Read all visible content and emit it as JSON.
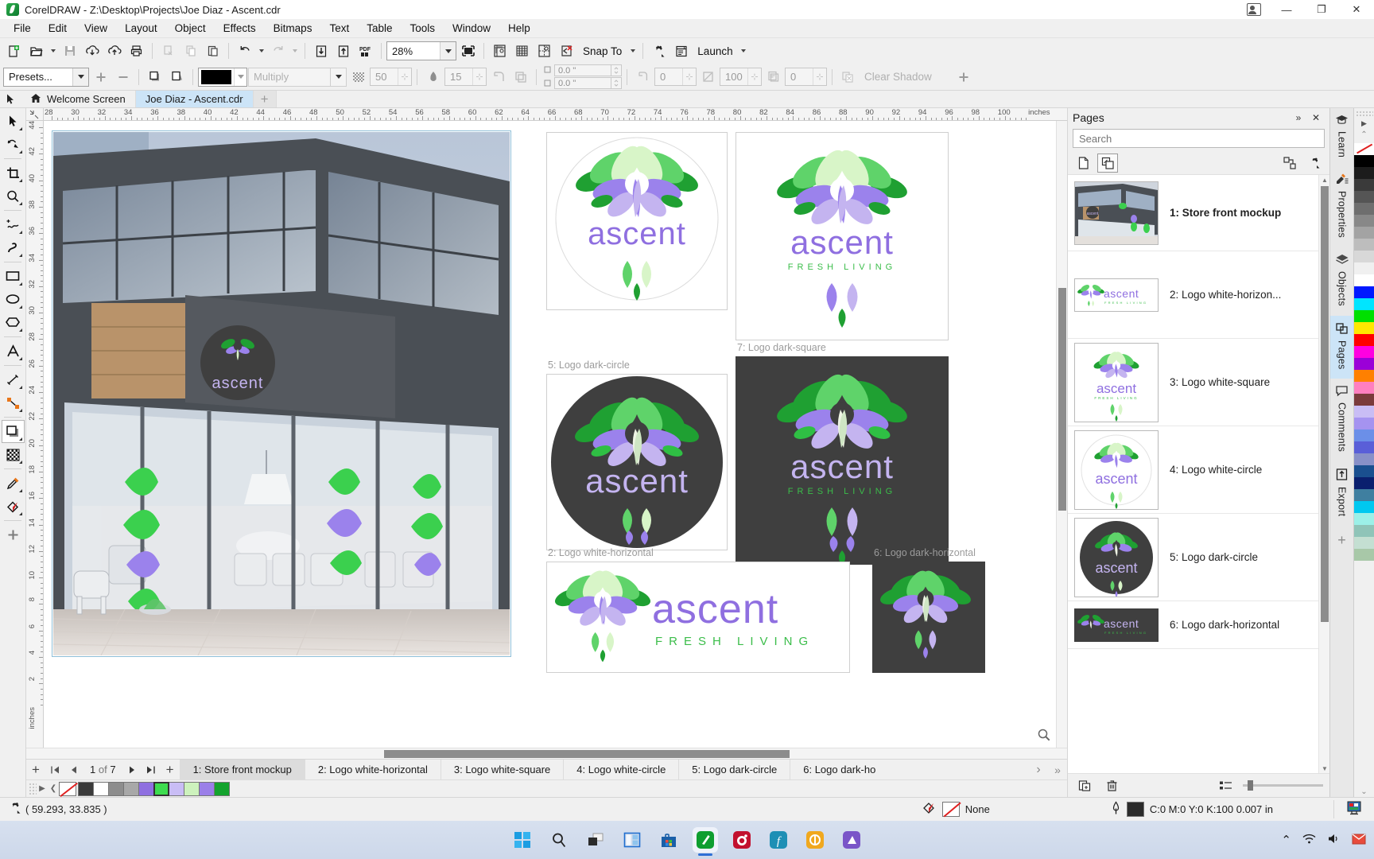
{
  "titlebar": {
    "app_name": "CorelDRAW",
    "title": "CorelDRAW - Z:\\Desktop\\Projects\\Joe Diaz - Ascent.cdr",
    "minimize": "—",
    "maximize": "❐",
    "close": "✕"
  },
  "menubar": {
    "items": [
      {
        "label": "File"
      },
      {
        "label": "Edit"
      },
      {
        "label": "View"
      },
      {
        "label": "Layout"
      },
      {
        "label": "Object"
      },
      {
        "label": "Effects"
      },
      {
        "label": "Bitmaps"
      },
      {
        "label": "Text"
      },
      {
        "label": "Table"
      },
      {
        "label": "Tools"
      },
      {
        "label": "Window"
      },
      {
        "label": "Help"
      }
    ]
  },
  "toolbar": {
    "zoom_level": "28%",
    "snap_to_label": "Snap To",
    "launch_label": "Launch",
    "items": [
      {
        "name": "new-document",
        "title": "New"
      },
      {
        "name": "open-document",
        "title": "Open"
      },
      {
        "name": "save-document",
        "title": "Save"
      },
      {
        "name": "import",
        "title": "Import"
      },
      {
        "name": "export",
        "title": "Export"
      },
      {
        "name": "print",
        "title": "Print"
      },
      {
        "name": "cut",
        "title": "Cut"
      },
      {
        "name": "copy",
        "title": "Copy"
      },
      {
        "name": "paste",
        "title": "Paste"
      },
      {
        "name": "undo",
        "title": "Undo"
      },
      {
        "name": "redo",
        "title": "Redo"
      },
      {
        "name": "publish-pdf",
        "title": "Publish to PDF"
      }
    ]
  },
  "propbar": {
    "presets_label": "Presets...",
    "merge_mode": "Multiply",
    "opacity": "50",
    "feather": "15",
    "offset_x": "0.0 \"",
    "offset_y": "0.0 \"",
    "stretch": "0",
    "fade": "100",
    "shadow_angle": "0",
    "clear_shadow_label": "Clear Shadow"
  },
  "doctabs": {
    "tabs": [
      {
        "label": "Welcome Screen",
        "active": false,
        "icon": "home-icon"
      },
      {
        "label": "Joe Diaz - Ascent.cdr",
        "active": true,
        "icon": null
      }
    ],
    "new_tab": "+"
  },
  "toolbox": {
    "tools": [
      {
        "name": "pick-tool",
        "selected": false
      },
      {
        "name": "shape-tool",
        "selected": false
      },
      {
        "name": "crop-tool",
        "selected": false
      },
      {
        "name": "zoom-tool",
        "selected": false
      },
      {
        "name": "freehand-tool",
        "selected": false
      },
      {
        "name": "artistic-media-tool",
        "selected": false
      },
      {
        "name": "rectangle-tool",
        "selected": false
      },
      {
        "name": "ellipse-tool",
        "selected": false
      },
      {
        "name": "polygon-tool",
        "selected": false
      },
      {
        "name": "text-tool",
        "selected": false
      },
      {
        "name": "parallel-dimension-tool",
        "selected": false
      },
      {
        "name": "straight-line-connector-tool",
        "selected": false
      },
      {
        "name": "drop-shadow-tool",
        "selected": true
      },
      {
        "name": "transparency-tool",
        "selected": false
      },
      {
        "name": "color-eyedropper-tool",
        "selected": false
      },
      {
        "name": "interactive-fill-tool",
        "selected": false
      },
      {
        "name": "add-tool",
        "selected": false
      }
    ]
  },
  "rulers": {
    "unit_label": "inches",
    "h_ticks": [
      "28",
      "30",
      "32",
      "34",
      "36",
      "38",
      "40",
      "42",
      "44",
      "46",
      "48",
      "50",
      "52",
      "54",
      "56",
      "58",
      "60",
      "62",
      "64",
      "66",
      "68",
      "70",
      "72",
      "74",
      "76",
      "78",
      "80",
      "82",
      "84",
      "86",
      "88",
      "90",
      "92",
      "94",
      "96",
      "98",
      "100"
    ],
    "v_ticks": [
      "44",
      "42",
      "40",
      "38",
      "36",
      "34",
      "32",
      "30",
      "28",
      "26",
      "24",
      "22",
      "20",
      "18",
      "16",
      "14",
      "12",
      "10",
      "8",
      "6",
      "4",
      "2"
    ],
    "v_unit_label": "inches"
  },
  "canvas": {
    "artboards": [
      {
        "label": "",
        "name": "store-front-mockup-art"
      },
      {
        "label": "4: Logo white-circle",
        "name": "logo-white-circle-art"
      },
      {
        "label": "3: Logo white-square",
        "name": "logo-white-square-art"
      },
      {
        "label": "5: Logo dark-circle",
        "name": "logo-dark-circle-art"
      },
      {
        "label": "7: Logo dark-square",
        "name": "logo-dark-square-art"
      },
      {
        "label": "2: Logo white-horizontal",
        "name": "logo-white-horizontal-art"
      },
      {
        "label": "6: Logo dark-horizontal",
        "name": "logo-dark-horizontal-art"
      }
    ],
    "brand_name": "ascent",
    "brand_tagline": "FRESH LIVING",
    "colors": {
      "purple": "#8f6fe0",
      "light_purple": "#c4b4f0",
      "green": "#22a038",
      "light_green": "#5fd36a",
      "pale_green": "#d8f5c8",
      "dark_bg": "#3f3f3f"
    }
  },
  "pagenav": {
    "add_page_before": "+",
    "first": "⏮",
    "prev": "◀",
    "counter_current": "1",
    "counter_of": "of",
    "counter_total": "7",
    "next": "▶",
    "last": "⏭",
    "add_page_after": "+",
    "tabs": [
      {
        "label": "1: Store front mockup",
        "active": true
      },
      {
        "label": "2: Logo white-horizontal",
        "active": false
      },
      {
        "label": "3: Logo white-square",
        "active": false
      },
      {
        "label": "4: Logo white-circle",
        "active": false
      },
      {
        "label": "5: Logo dark-circle",
        "active": false
      },
      {
        "label": "6: Logo dark-horizontal",
        "active": false
      }
    ],
    "scroll_right": "›",
    "scroll_more": "»"
  },
  "palette": {
    "swatches": [
      "none",
      "#3a3a3a",
      "#ffffff",
      "#8d8d8d",
      "#a8a8a8",
      "#8f6fe0",
      "#3ddc4f",
      "#c9bdf5",
      "#cdf2bd",
      "#9b7fe8",
      "#14a32e"
    ],
    "selected_index": 6
  },
  "docker": {
    "title": "Pages",
    "collapse_icon": "»",
    "close_icon": "✕",
    "search_placeholder": "Search",
    "view_single_page": "single-page-view",
    "view_multi_page": "multi-page-view",
    "options_icon": "options-icon",
    "settings_icon": "gear-icon",
    "pages": [
      {
        "label": "1: Store front mockup",
        "type": "mockup",
        "current": true
      },
      {
        "label": "2: Logo white-horizon...",
        "type": "white-horizontal",
        "current": false
      },
      {
        "label": "3: Logo white-square",
        "type": "white-square",
        "current": false
      },
      {
        "label": "4: Logo white-circle",
        "type": "white-circle",
        "current": false
      },
      {
        "label": "5: Logo dark-circle",
        "type": "dark-circle",
        "current": false
      },
      {
        "label": "6: Logo dark-horizontal",
        "type": "dark-horizontal",
        "current": false
      }
    ],
    "footer": {
      "new_page_icon": "new-page-icon",
      "delete_page_icon": "trash-icon",
      "list_view_icon": "list-view-icon"
    }
  },
  "rail": {
    "tabs": [
      {
        "label": "Learn",
        "icon": "graduation-cap-icon",
        "active": false
      },
      {
        "label": "Properties",
        "icon": "properties-icon",
        "active": false
      },
      {
        "label": "Objects",
        "icon": "layers-icon",
        "active": false
      },
      {
        "label": "Pages",
        "icon": "pages-icon",
        "active": true
      },
      {
        "label": "Comments",
        "icon": "comment-icon",
        "active": false
      },
      {
        "label": "Export",
        "icon": "export-icon",
        "active": false
      }
    ],
    "add_docker": "+",
    "palette_colors": [
      "#e02020",
      "#000000",
      "#1c1c1c",
      "#3a3a3a",
      "#555555",
      "#6e6e6e",
      "#888888",
      "#a3a3a3",
      "#bdbdbd",
      "#d8d8d8",
      "#f0f0f0",
      "#ffffff",
      "#0018ff",
      "#00e5ff",
      "#00e000",
      "#ffe800",
      "#ff0000",
      "#ff00e1",
      "#9b00d8",
      "#ff8000",
      "#ff7fbf",
      "#7a3b3b",
      "#c9bdf5",
      "#a593f0",
      "#6b8fe8",
      "#5a5fd8",
      "#8890c8",
      "#1a4f8f",
      "#0a1f6e",
      "#3f7fa0",
      "#00c8f0",
      "#9cf0e8",
      "#8fc4b8",
      "#c4dfd2",
      "#a8c8a8"
    ]
  },
  "statusbar": {
    "coords": "( 59.293, 33.835 )",
    "fill_label": "None",
    "outline_label": "C:0 M:0 Y:0 K:100  0.007 in",
    "color_proof_icon": "color-proof-icon"
  },
  "taskbar": {
    "items": [
      {
        "name": "start-button",
        "icon": "windows-logo"
      },
      {
        "name": "search-taskbar",
        "icon": "search-icon"
      },
      {
        "name": "task-view",
        "icon": "task-view-icon"
      },
      {
        "name": "widgets",
        "icon": "widgets-icon"
      },
      {
        "name": "microsoft-store",
        "icon": "store-icon"
      },
      {
        "name": "coreldraw-taskbar",
        "icon": "coreldraw-icon",
        "active": true
      },
      {
        "name": "photo-paint-taskbar",
        "icon": "photopaint-icon"
      },
      {
        "name": "font-manager-taskbar",
        "icon": "fontmanager-icon"
      },
      {
        "name": "capture-taskbar",
        "icon": "capture-icon"
      },
      {
        "name": "connect-taskbar",
        "icon": "connect-icon"
      }
    ],
    "tray": {
      "chevron": "⌃",
      "network_icon": "network-icon",
      "volume_icon": "volume-icon",
      "notify_icon": "notification-icon"
    }
  }
}
